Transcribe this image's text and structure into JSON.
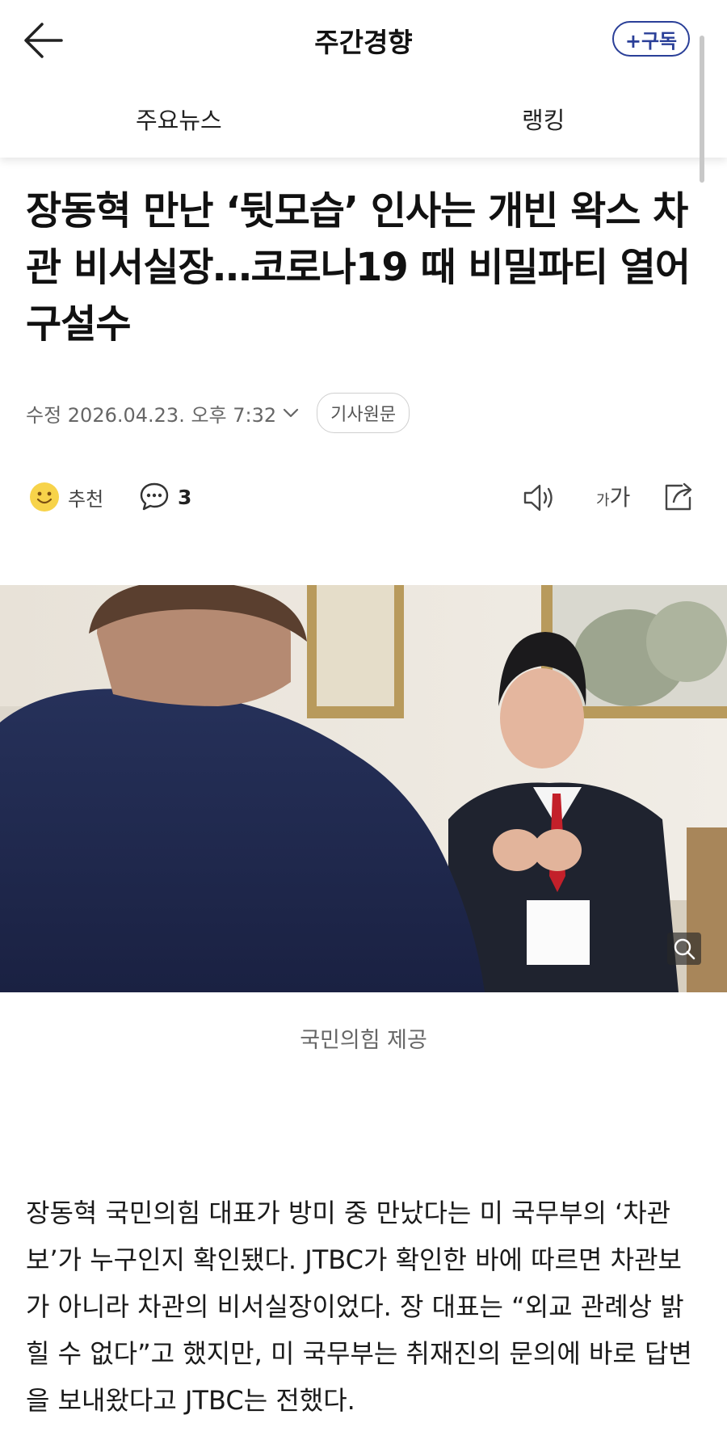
{
  "header": {
    "title": "주간경향",
    "subscribe_label": "+구독",
    "tabs": [
      {
        "label": "주요뉴스"
      },
      {
        "label": "랭킹"
      }
    ]
  },
  "article": {
    "headline": "장동혁 만난 ‘뒷모습’ 인사는 개빈 왁스 차관 비서실장…코로나19 때 비밀파티 열어 구설수",
    "date": "수정 2026.04.23. 오후 7:32",
    "original_label": "기사원문",
    "actions": {
      "recommend_label": "추천",
      "comment_count": "3",
      "font_label_small": "가",
      "font_label_large": "가"
    },
    "photo_caption": "국민의힘 제공",
    "paragraph_part1": "장동혁 국민의힘 대표가 방미 중 만났다는 미 국무부의 ‘차관보’가 누구인지 확인됐다. JTBC가 확인한 바에 따르면 ",
    "paragraph_highlight": "차관보가 아니라 차관의 비서실장",
    "paragraph_part2": "이었다. 장 대표는 “외교 관례상 밝힐 수 없다”고 했지만, 미 국무부는 취재진의 문의에 바로 답변을 보내왔다고 JTBC는 전했다."
  },
  "colors": {
    "accent": "#2a3f98",
    "highlight_underline": "#e0141e"
  }
}
